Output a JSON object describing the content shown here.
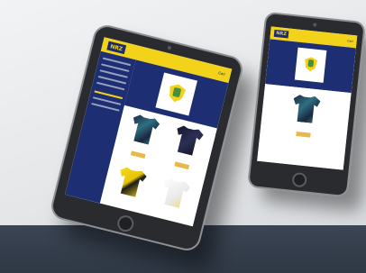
{
  "brand": {
    "logo_text": "NRZ",
    "accent": "#f3d21a",
    "primary": "#1d2e73"
  },
  "tablet": {
    "cart_text": "Cart",
    "sidebar": {
      "title": "",
      "items": [
        "",
        "",
        "",
        "",
        ""
      ]
    },
    "banner_name": "",
    "products": [
      {
        "name": "",
        "price": "",
        "button": ""
      },
      {
        "name": "",
        "price": "",
        "button": ""
      },
      {
        "name": "",
        "price": "",
        "button": ""
      },
      {
        "name": "",
        "price": "",
        "button": ""
      }
    ]
  },
  "phone": {
    "cart_text": "Cart",
    "banner_name": "",
    "products": [
      {
        "name": "",
        "price": "",
        "button": ""
      }
    ]
  },
  "icons": [
    "shield-logo-icon",
    "cart-icon",
    "home-button-icon"
  ]
}
